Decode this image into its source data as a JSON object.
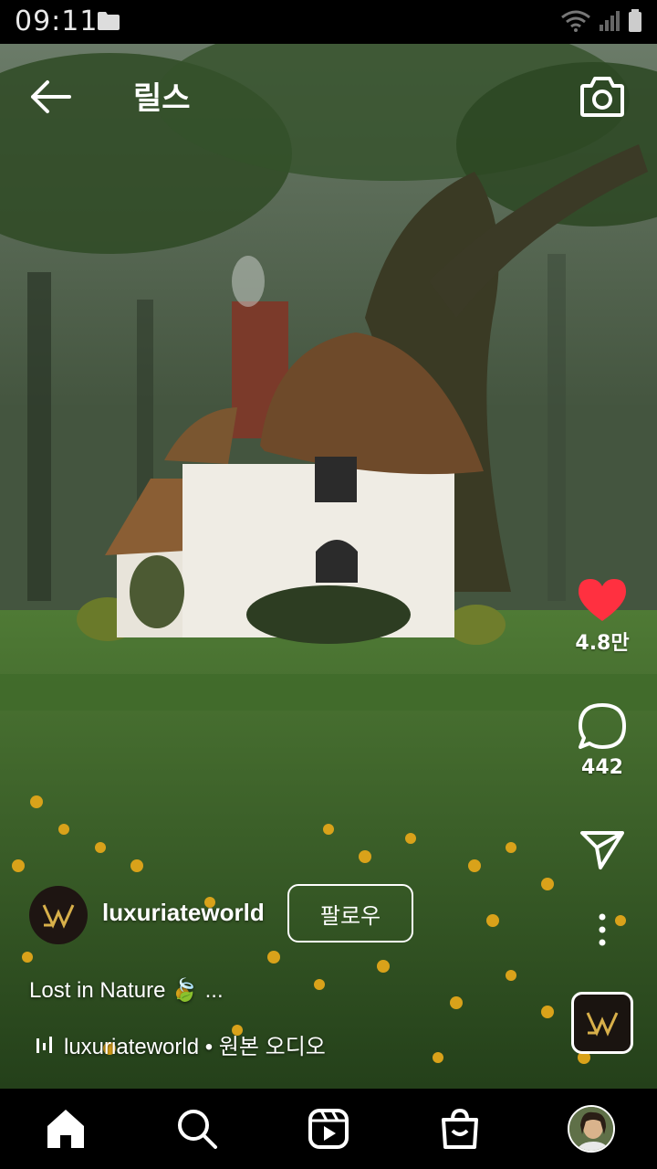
{
  "status_bar": {
    "time": "09:11",
    "icons": [
      "folder-icon",
      "wifi-icon",
      "signal-icon",
      "battery-icon"
    ]
  },
  "header": {
    "title": "릴스",
    "back_icon": "arrow-left-icon",
    "camera_icon": "camera-icon"
  },
  "actions": {
    "like_count": "4.8만",
    "comment_count": "442",
    "like_color": "#ff3040"
  },
  "author": {
    "username": "luxuriateworld",
    "follow_label": "팔로우",
    "logo_text": "LW"
  },
  "caption": "Lost in Nature 🍃 ...",
  "audio": {
    "label": "luxuriateworld • 원본 오디오"
  },
  "bottom_nav": {
    "items": [
      "home-icon",
      "search-icon",
      "reels-icon",
      "shop-icon",
      "profile-avatar"
    ]
  }
}
